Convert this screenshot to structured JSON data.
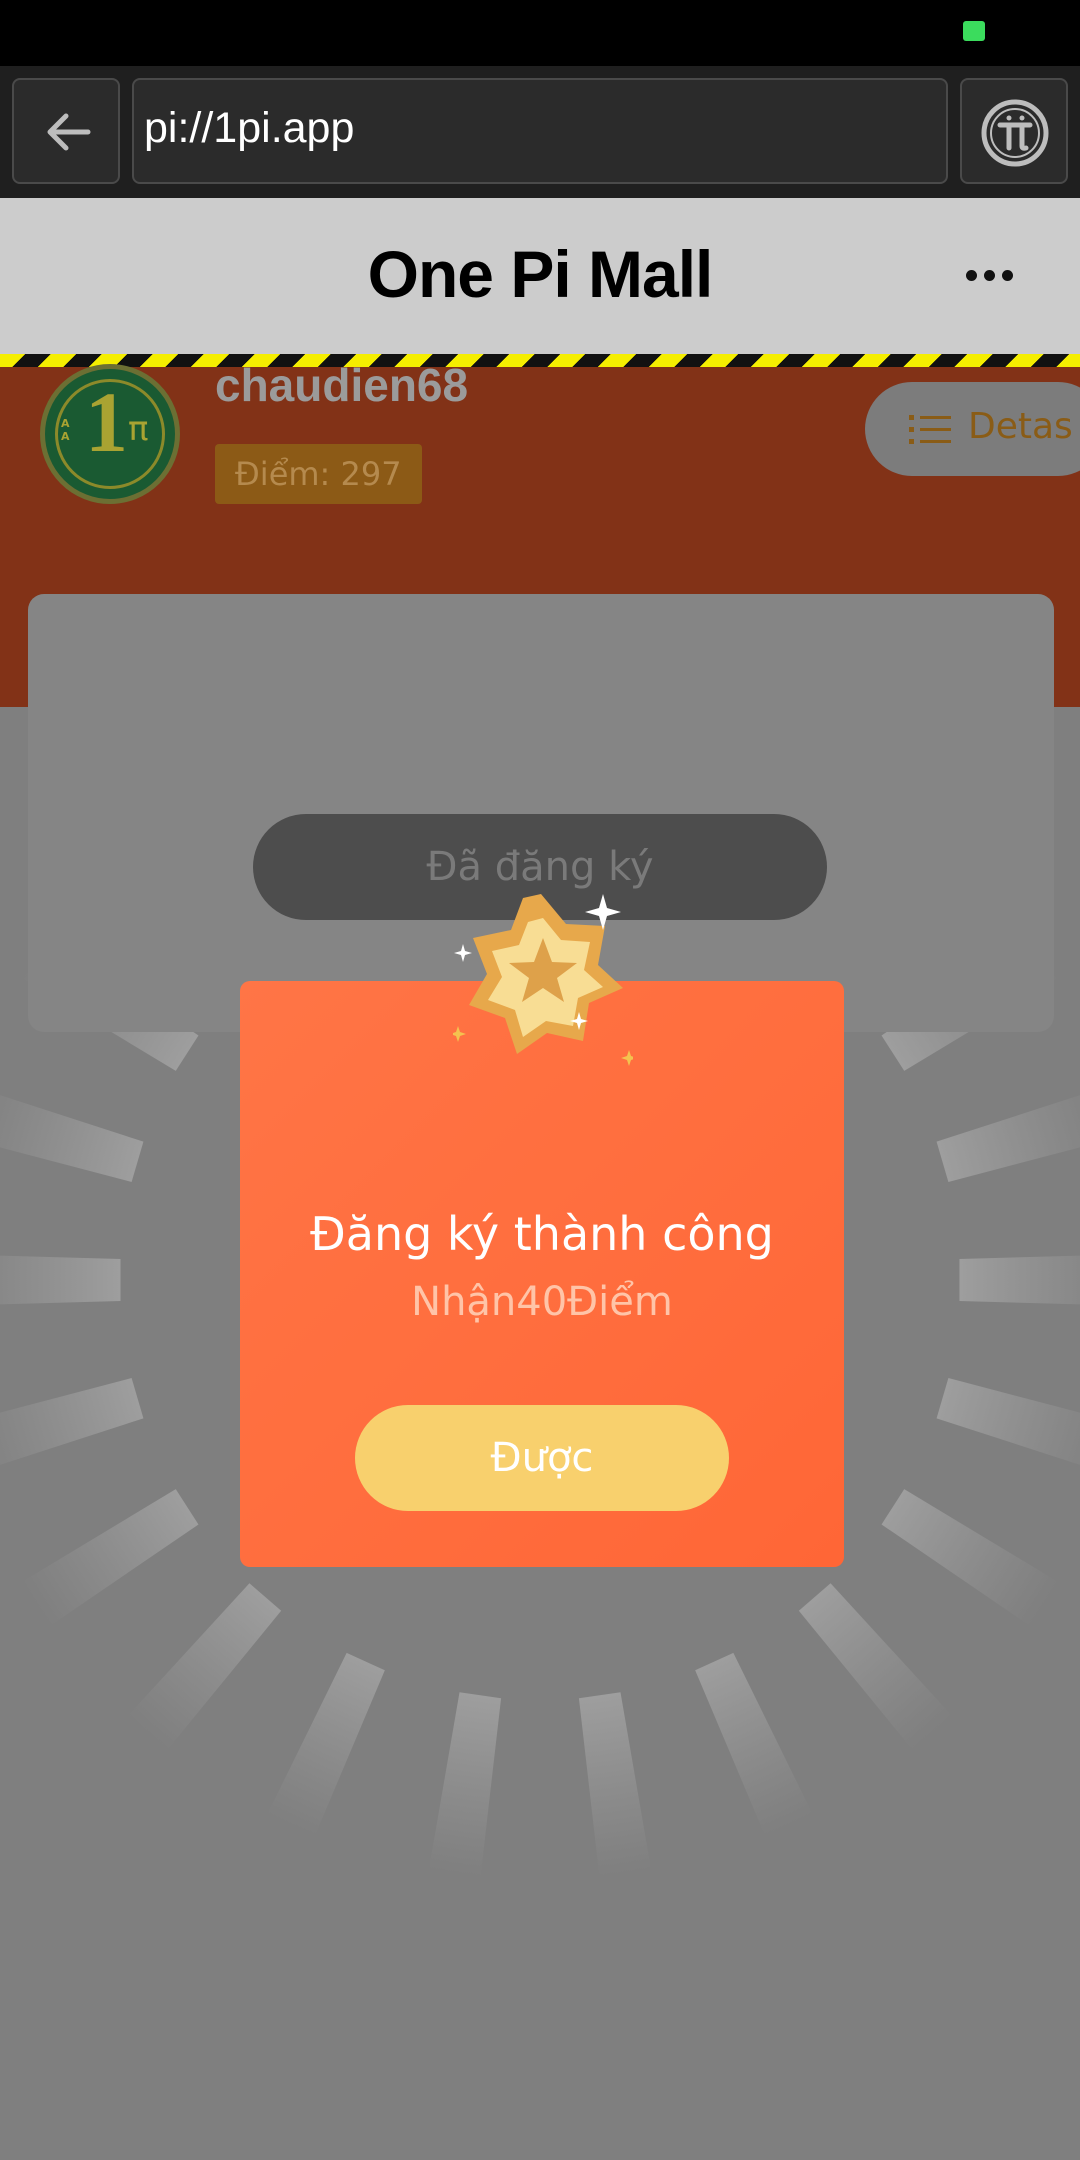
{
  "browser": {
    "url": "pi://1pi.app"
  },
  "header": {
    "title": "One Pi Mall"
  },
  "profile": {
    "username": "chaudien68",
    "points_label": "Điểm: 297",
    "details_button": "Detas"
  },
  "registration": {
    "registered_label": "Đã đăng ký"
  },
  "modal": {
    "title": "Đăng ký thành công",
    "subtitle": "Nhận40Điểm",
    "ok_button": "Được"
  },
  "colors": {
    "hazard_yellow": "#f5ee00",
    "profile_band": "#823217",
    "modal_orange": "#ff5d2a",
    "ok_button": "#f8d06d"
  },
  "icons": [
    "battery-icon",
    "back-arrow-icon",
    "pi-network-icon",
    "more-dots-icon",
    "list-icon",
    "star-badge-icon",
    "sparkle-icon"
  ]
}
